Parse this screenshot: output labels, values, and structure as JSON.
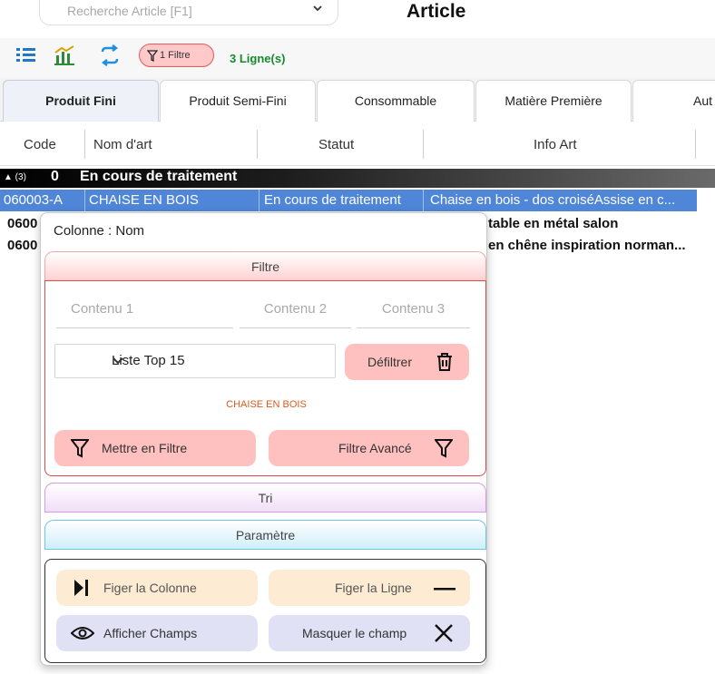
{
  "search": {
    "placeholder": "Recherche Article [F1]"
  },
  "window": {
    "title": "Article"
  },
  "toolbar": {
    "filter_badge": "1 Filtre",
    "lines_count": "3 Ligne(s)",
    "icons": [
      "list-icon",
      "chart-icon",
      "refresh-icon",
      "filter-icon"
    ]
  },
  "tabs": [
    {
      "label": "Produit Fini",
      "active": true
    },
    {
      "label": "Produit Semi-Fini",
      "active": false
    },
    {
      "label": "Consommable",
      "active": false
    },
    {
      "label": "Matière Première",
      "active": false
    },
    {
      "label": "Aut",
      "active": false
    }
  ],
  "columns": [
    "Code",
    "Nom d'art",
    "Statut",
    "Info Art"
  ],
  "group": {
    "count": "▲ (3)",
    "code": "0",
    "label": "En cours de traitement"
  },
  "rows": [
    {
      "code": "060003-A",
      "name": "CHAISE EN BOIS",
      "status": "En cours de traitement",
      "info": "Chaise en bois - dos croiséAssise en c..."
    },
    {
      "code": "0600",
      "info": "table en métal salon"
    },
    {
      "code": "0600",
      "info": "en chêne inspiration norman..."
    }
  ],
  "popup": {
    "title": "Colonne : Nom",
    "filtre_header": "Filtre",
    "content_1": "Contenu 1",
    "content_2": "Contenu 2",
    "content_3": "Contenu 3",
    "select_value": "Liste Top 15",
    "defiltrer": "Défiltrer",
    "current_value": "CHAISE EN BOIS",
    "mettre_en_filtre": "Mettre en Filtre",
    "filtre_avance": "Filtre Avancé",
    "tri_header": "Tri",
    "parametre_header": "Paramètre",
    "figer_colonne": "Figer la Colonne",
    "figer_ligne": "Figer la Ligne",
    "afficher_champs": "Afficher Champs",
    "masquer_champ": "Masquer le champ"
  },
  "colors": {
    "selected_row": "#4f86d8",
    "filter_border": "#e14b4b",
    "filter_button": "#ffc0c0",
    "lines_green": "#178a2d",
    "param_orange": "#fdebd3",
    "param_lavender": "#e1e1f5"
  }
}
